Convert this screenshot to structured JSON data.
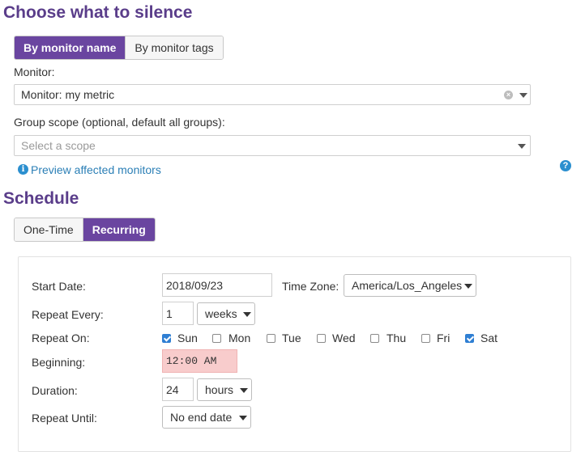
{
  "silence": {
    "title": "Choose what to silence",
    "tabs": [
      {
        "label": "By monitor name",
        "active": true
      },
      {
        "label": "By monitor tags",
        "active": false
      }
    ],
    "monitor_label": "Monitor:",
    "monitor_value": "Monitor: my metric",
    "group_scope_label": "Group scope (optional, default all groups):",
    "group_scope_placeholder": "Select a scope",
    "preview_link": "Preview affected monitors",
    "help_icon": "question-circle-icon"
  },
  "schedule": {
    "title": "Schedule",
    "tabs": [
      {
        "label": "One-Time",
        "active": false
      },
      {
        "label": "Recurring",
        "active": true
      }
    ],
    "start_date_label": "Start Date:",
    "start_date_value": "2018/09/23",
    "timezone_label": "Time Zone:",
    "timezone_value": "America/Los_Angeles",
    "repeat_every_label": "Repeat Every:",
    "repeat_every_value": "1",
    "repeat_every_unit": "weeks",
    "repeat_on_label": "Repeat On:",
    "days": [
      {
        "label": "Sun",
        "checked": true
      },
      {
        "label": "Mon",
        "checked": false
      },
      {
        "label": "Tue",
        "checked": false
      },
      {
        "label": "Wed",
        "checked": false
      },
      {
        "label": "Thu",
        "checked": false
      },
      {
        "label": "Fri",
        "checked": false
      },
      {
        "label": "Sat",
        "checked": true
      }
    ],
    "beginning_label": "Beginning:",
    "beginning_value": "12:00 AM",
    "duration_label": "Duration:",
    "duration_value": "24",
    "duration_unit": "hours",
    "repeat_until_label": "Repeat Until:",
    "repeat_until_value": "No end date"
  },
  "colors": {
    "accent": "#6a45a0",
    "heading": "#5a3d8a",
    "link": "#2b7fb6",
    "error_field": "#f8cccc"
  }
}
